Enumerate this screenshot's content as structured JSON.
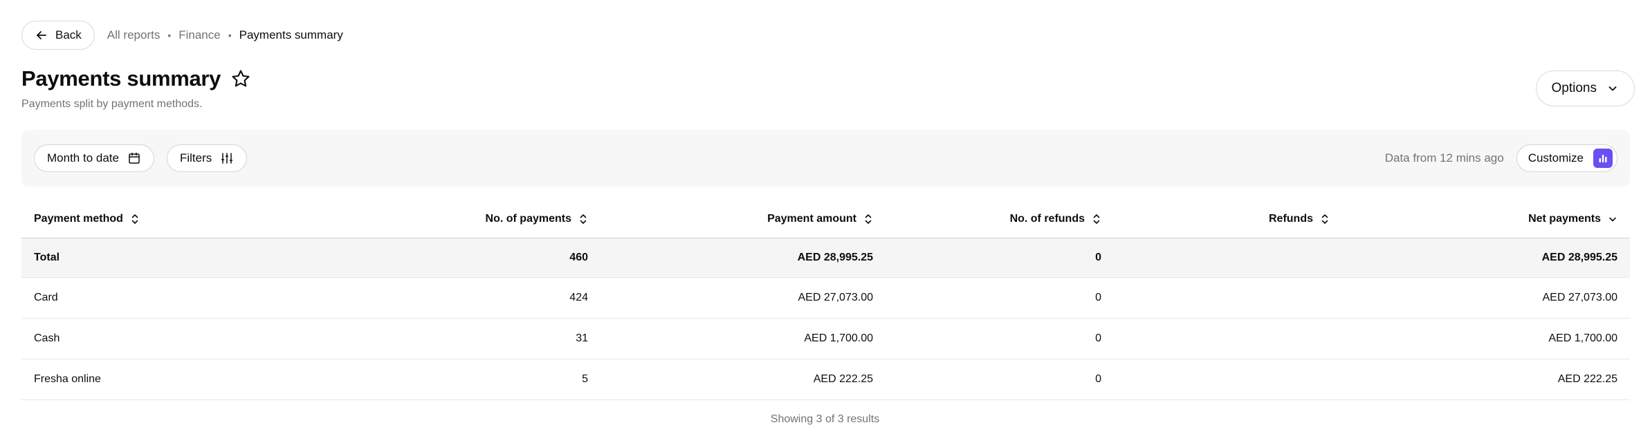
{
  "topbar": {
    "back_label": "Back",
    "breadcrumbs": [
      "All reports",
      "Finance",
      "Payments summary"
    ]
  },
  "header": {
    "title": "Payments summary",
    "subtitle": "Payments split by payment methods.",
    "options_label": "Options"
  },
  "toolbar": {
    "date_filter_label": "Month to date",
    "filters_label": "Filters",
    "data_freshness": "Data from 12 mins ago",
    "customize_label": "Customize",
    "accent_color": "#6950f3"
  },
  "table": {
    "columns": [
      {
        "label": "Payment method",
        "sort": "both"
      },
      {
        "label": "No. of payments",
        "sort": "both"
      },
      {
        "label": "Payment amount",
        "sort": "both"
      },
      {
        "label": "No. of refunds",
        "sort": "both"
      },
      {
        "label": "Refunds",
        "sort": "both"
      },
      {
        "label": "Net payments",
        "sort": "descending"
      }
    ],
    "total": [
      "Total",
      "460",
      "AED 28,995.25",
      "0",
      "",
      "AED 28,995.25"
    ],
    "rows": [
      [
        "Card",
        "424",
        "AED 27,073.00",
        "0",
        "",
        "AED 27,073.00"
      ],
      [
        "Cash",
        "31",
        "AED 1,700.00",
        "0",
        "",
        "AED 1,700.00"
      ],
      [
        "Fresha online",
        "5",
        "AED 222.25",
        "0",
        "",
        "AED 222.25"
      ]
    ]
  },
  "footer": {
    "results_text": "Showing 3 of 3 results"
  }
}
